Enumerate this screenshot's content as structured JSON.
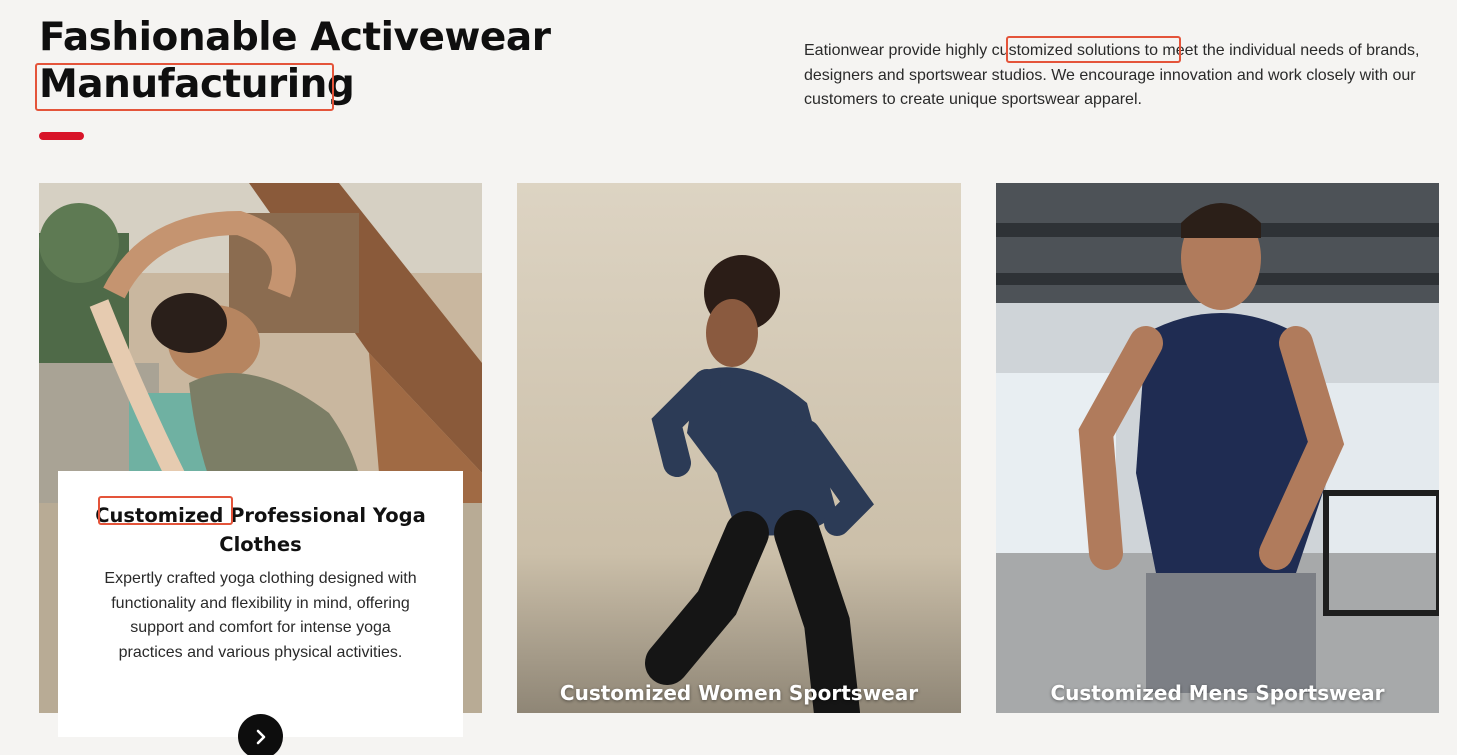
{
  "section": {
    "title_line1": "Fashionable Activewear",
    "title_line2": "Manufacturing",
    "intro_pre": "Eationwear provide highly ",
    "intro_highlight": "customized solutions",
    "intro_post": " to meet the individual needs of brands, designers and sportswear studios. We encourage innovation and work closely with our customers to create unique sportswear apparel."
  },
  "cards": [
    {
      "title_highlight": "Customized",
      "title_rest": " Professional Yoga Clothes",
      "description": "Expertly crafted yoga clothing designed with functionality and flexibility in mind, offering support and comfort for intense yoga practices and various physical activities.",
      "button_icon": "chevron-right-icon"
    },
    {
      "title": "Customized Women Sportswear"
    },
    {
      "title": "Customized Mens Sportswear"
    }
  ],
  "colors": {
    "accent": "#d81429",
    "highlight_box": "#e4543a",
    "background": "#f5f4f2"
  }
}
